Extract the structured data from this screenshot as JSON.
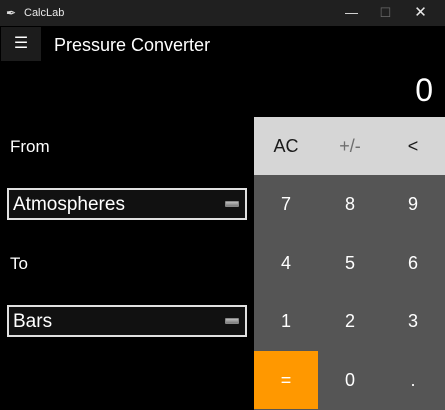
{
  "window": {
    "title": "CalcLab",
    "controls": {
      "minimize": "—",
      "maximize": "☐",
      "close": "✕"
    }
  },
  "header": {
    "menu_icon": "hamburger-menu-icon",
    "menu_glyph": "☰",
    "title": "Pressure Converter"
  },
  "display": {
    "value": "0"
  },
  "converter": {
    "from_label": "From",
    "from_value": "Atmospheres",
    "to_label": "To",
    "to_value": "Bars"
  },
  "keypad": {
    "row1": [
      "AC",
      "+/-",
      "<"
    ],
    "row2": [
      "7",
      "8",
      "9"
    ],
    "row3": [
      "4",
      "5",
      "6"
    ],
    "row4": [
      "1",
      "2",
      "3"
    ],
    "row5": [
      "=",
      "0",
      "."
    ]
  },
  "colors": {
    "background": "#000000",
    "keypad": "#555555",
    "keypad_top_row": "#d6d6d6",
    "equals_accent": "#ff9800"
  }
}
